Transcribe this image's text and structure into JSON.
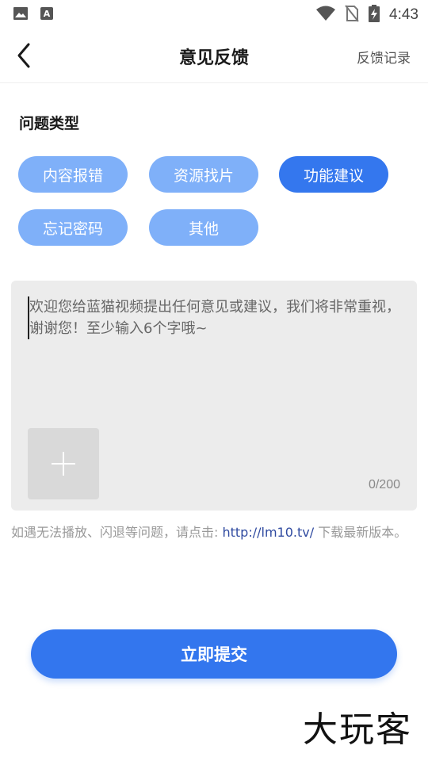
{
  "status_bar": {
    "time": "4:43",
    "left_icons": [
      "image-icon",
      "font-a-icon"
    ],
    "right_icons": [
      "wifi-icon",
      "no-sim-icon",
      "battery-charging-icon"
    ]
  },
  "header": {
    "title": "意见反馈",
    "back_icon": "chevron-left-icon",
    "action_label": "反馈记录"
  },
  "issue_type": {
    "title": "问题类型",
    "options": [
      {
        "label": "内容报错",
        "selected": false
      },
      {
        "label": "资源找片",
        "selected": false
      },
      {
        "label": "功能建议",
        "selected": true
      },
      {
        "label": "忘记密码",
        "selected": false
      },
      {
        "label": "其他",
        "selected": false
      }
    ]
  },
  "feedback": {
    "placeholder": "欢迎您给蓝猫视频提出任何意见或建议，我们将非常重视，谢谢您！至少输入6个字哦~",
    "value": "",
    "counter": "0/200",
    "add_image_icon": "plus-icon"
  },
  "hint": {
    "prefix": "如遇无法播放、闪退等问题，请点击: ",
    "link": "http://lm10.tv/",
    "suffix": " 下载最新版本。"
  },
  "submit_label": "立即提交",
  "watermark": "大玩客",
  "colors": {
    "accent": "#3477ee",
    "chip_inactive": "#7fb0f9",
    "input_bg": "#ececec",
    "link": "#2f4aa0"
  }
}
